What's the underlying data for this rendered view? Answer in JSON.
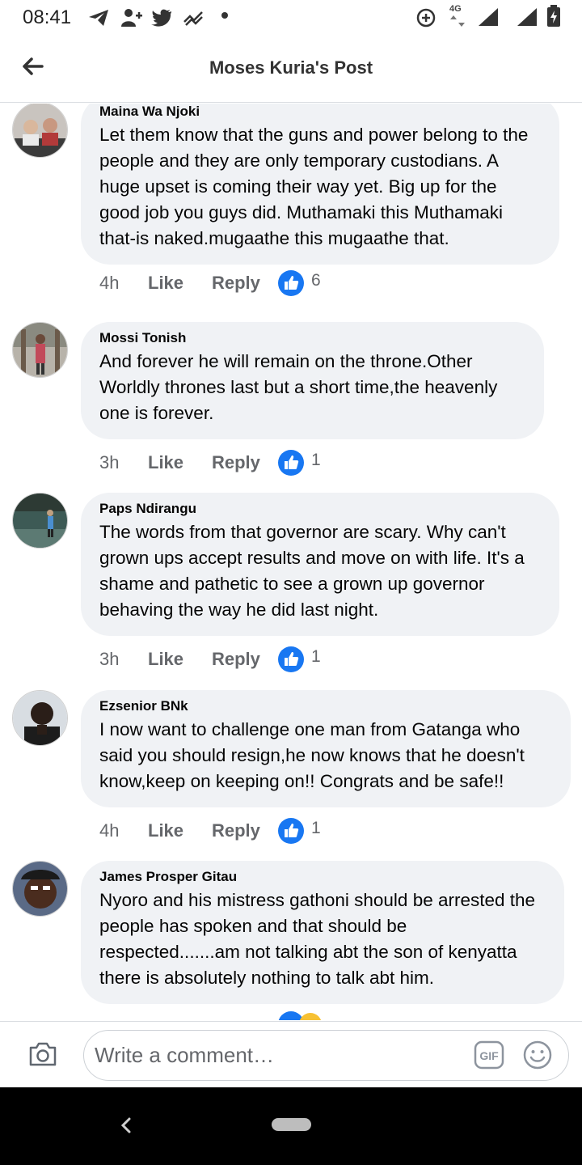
{
  "status_bar": {
    "time": "08:41",
    "network_label": "4G",
    "icons": [
      "telegram-icon",
      "add-person-icon",
      "twitter-icon",
      "missed-call-icon",
      "notification-dot-icon",
      "data-saver-icon",
      "signal-icon",
      "signal-icon",
      "battery-icon"
    ]
  },
  "header": {
    "title": "Moses Kuria's Post",
    "back_icon": "back-arrow-icon"
  },
  "comments": [
    {
      "author": "Maina Wa Njoki",
      "text": "Let them know that the guns and power belong to the people and they are only temporary custodians. A huge upset is coming their way yet. Big up for the good job you guys did. Muthamaki this Muthamaki that-is naked.mugaathe this mugaathe that.",
      "time": "4h",
      "like_label": "Like",
      "reply_label": "Reply",
      "reaction_count": "6"
    },
    {
      "author": "Mossi Tonish",
      "text": "And forever he will remain on the throne.Other Worldly thrones last but a short time,the heavenly one is forever.",
      "time": "3h",
      "like_label": "Like",
      "reply_label": "Reply",
      "reaction_count": "1"
    },
    {
      "author": "Paps Ndirangu",
      "text": "The words from that governor are scary. Why can't grown ups accept results and move on with life. It's a shame and pathetic to see a grown up governor behaving the way he did last night.",
      "time": "3h",
      "like_label": "Like",
      "reply_label": "Reply",
      "reaction_count": "1"
    },
    {
      "author": "Ezsenior BNk",
      "text": "I now want to challenge one man from Gatanga who said you should resign,he now knows that he doesn't know,keep on keeping on!! Congrats and be safe!!",
      "time": "4h",
      "like_label": "Like",
      "reply_label": "Reply",
      "reaction_count": "1"
    },
    {
      "author": "James Prosper Gitau",
      "text": "Nyoro and his mistress gathoni should be arrested the people has spoken and that should be respected.......am not talking abt the son of kenyatta there is absolutely nothing to talk abt him."
    }
  ],
  "composer": {
    "placeholder": "Write a comment…",
    "camera_icon": "camera-icon",
    "gif_icon": "gif-icon",
    "emoji_icon": "emoji-icon"
  },
  "colors": {
    "bubble": "#f0f2f5",
    "meta_text": "#65676b",
    "like_blue": "#1877f2"
  }
}
